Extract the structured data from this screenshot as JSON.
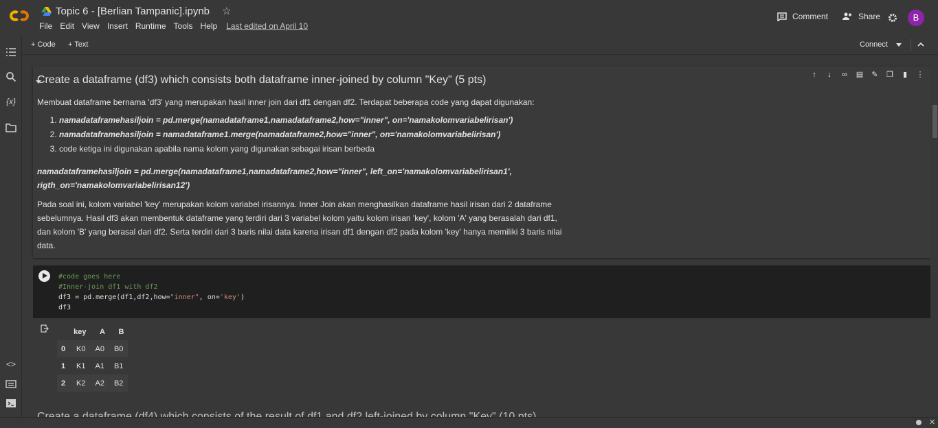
{
  "header": {
    "title": "Topic 6 - [Berlian Tampanic].ipynb",
    "menu": [
      "File",
      "Edit",
      "View",
      "Insert",
      "Runtime",
      "Tools",
      "Help"
    ],
    "last_edited": "Last edited on April 10",
    "comment_label": "Comment",
    "share_label": "Share",
    "avatar_letter": "B",
    "brand_color": "#f9ab00",
    "avatar_color": "#8e24aa"
  },
  "toolbar": {
    "code_label": "Code",
    "text_label": "Text",
    "connect_label": "Connect"
  },
  "text_cell": {
    "heading": "Create a dataframe (df3) which consists both dataframe inner-joined by column \"Key\" (5 pts)",
    "intro": "Membuat dataframe bernama 'df3' yang merupakan hasil inner join dari df1 dengan df2. Terdapat beberapa code yang dapat digunakan:",
    "list": [
      "namadataframehasiljoin = pd.merge(namadataframe1,namadataframe2,how=\"inner\", on='namakolomvariabelirisan')",
      "namadataframehasiljoin = namadataframe1.merge(namadataframe2,how=\"inner\", on='namakolomvariabelirisan')",
      "code ketiga ini digunakan apabila nama kolom yang digunakan sebagai irisan berbeda"
    ],
    "code_example_line1": "namadataframehasiljoin = pd.merge(namadataframe1,namadataframe2,how=\"inner\", left_on='namakolomvariabelirisan1',",
    "code_example_line2": "rigth_on='namakolomvariabelirisan12')",
    "para_line1": "Pada soal ini, kolom variabel 'key' merupakan kolom variabel irisannya. Inner Join akan menghasilkan dataframe hasil irisan dari 2 dataframe",
    "para_line2": "sebelumnya. Hasil df3 akan membentuk dataframe yang terdiri dari 3 variabel kolom yaitu kolom irisan 'key', kolom 'A' yang berasalah dari df1,",
    "para_line3": "dan kolom 'B' yang berasal dari df2. Serta terdiri dari 3 baris nilai data karena irisan df1 dengan df2 pada kolom 'key' hanya memiliki 3 baris nilai",
    "para_line4": "data."
  },
  "code_cell": {
    "line1": "#code goes here",
    "line2": "#Inner-join df1 with df2",
    "line3_prefix": "df3 = pd.merge(df1,df2,how=",
    "line3_str1": "\"inner\"",
    "line3_mid": ", on=",
    "line3_str2": "'key'",
    "line3_suffix": ")",
    "line4": "df3"
  },
  "output_table": {
    "columns": [
      "",
      "key",
      "A",
      "B"
    ],
    "rows": [
      [
        "0",
        "K0",
        "A0",
        "B0"
      ],
      [
        "1",
        "K1",
        "A1",
        "B1"
      ],
      [
        "2",
        "K2",
        "A2",
        "B2"
      ]
    ]
  },
  "next_heading": "Create a dataframe (df4) which consists of the result of df1 and df2 left-joined by column \"Key\" (10 pts)"
}
